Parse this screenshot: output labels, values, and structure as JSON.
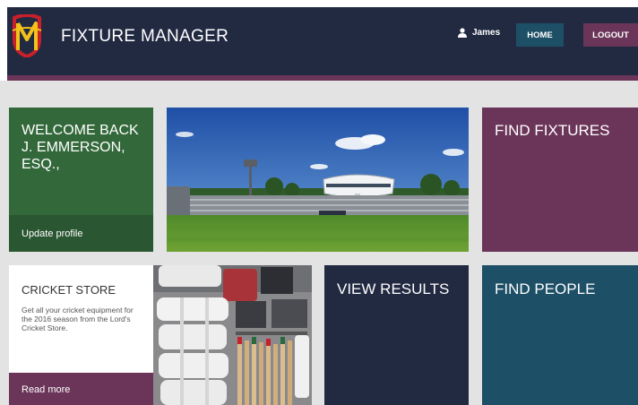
{
  "header": {
    "app_title": "FIXTURE MANAGER",
    "user_name": "James",
    "home_label": "HOME",
    "logout_label": "LOGOUT"
  },
  "tiles": {
    "welcome": {
      "title_line1": "WELCOME BACK",
      "title_line2": "J. EMMERSON,",
      "title_line3": "ESQ.,",
      "link": "Update profile"
    },
    "find_fixtures": {
      "title": "FIND FIXTURES"
    },
    "store": {
      "title": "CRICKET STORE",
      "description": "Get all your cricket equipment for the 2016 season from the Lord's Cricket Store.",
      "link": "Read more"
    },
    "view_results": {
      "title": "VIEW RESULTS"
    },
    "find_people": {
      "title": "FIND PEOPLE"
    }
  },
  "colors": {
    "navy": "#222a42",
    "plum": "#6b3559",
    "green": "#33693a",
    "teal": "#1d4f66",
    "background": "#e3e3e3"
  },
  "icons": {
    "logo": "mcc-logo",
    "user": "user-icon"
  }
}
